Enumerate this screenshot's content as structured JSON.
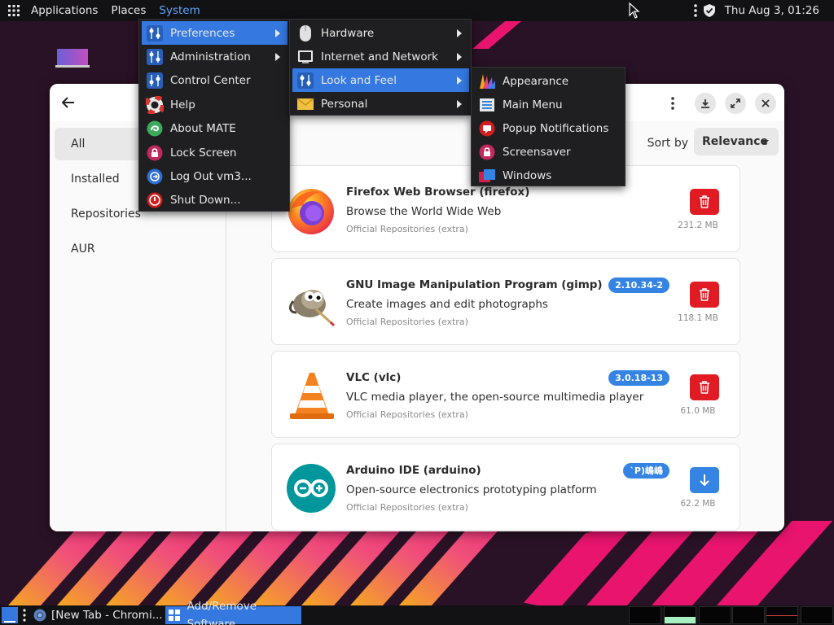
{
  "top_panel": {
    "menus": [
      "Applications",
      "Places",
      "System"
    ],
    "clock": "Thu Aug  3, 01:26"
  },
  "system_menu": {
    "items": [
      {
        "label": "Preferences",
        "icon": "preferences-icon",
        "submenu": true
      },
      {
        "label": "Administration",
        "icon": "administration-icon",
        "submenu": true
      },
      {
        "label": "Control Center",
        "icon": "control-center-icon",
        "submenu": false
      },
      {
        "label": "Help",
        "icon": "help-lifebuoy-icon",
        "submenu": false
      },
      {
        "label": "About MATE",
        "icon": "mate-logo-icon",
        "submenu": false
      },
      {
        "label": "Lock Screen",
        "icon": "lock-icon",
        "submenu": false
      },
      {
        "label": "Log Out vm3...",
        "icon": "logout-icon",
        "submenu": false
      },
      {
        "label": "Shut Down...",
        "icon": "power-icon",
        "submenu": false
      }
    ]
  },
  "preferences_menu": {
    "items": [
      {
        "label": "Hardware",
        "icon": "mouse-icon"
      },
      {
        "label": "Internet and Network",
        "icon": "network-icon"
      },
      {
        "label": "Look and Feel",
        "icon": "look-and-feel-icon"
      },
      {
        "label": "Personal",
        "icon": "personal-envelope-icon"
      }
    ]
  },
  "look_feel_menu": {
    "items": [
      {
        "label": "Appearance",
        "icon": "appearance-icon"
      },
      {
        "label": "Main Menu",
        "icon": "main-menu-icon"
      },
      {
        "label": "Popup Notifications",
        "icon": "popup-notifications-icon"
      },
      {
        "label": "Screensaver",
        "icon": "screensaver-icon"
      },
      {
        "label": "Windows",
        "icon": "windows-icon"
      }
    ]
  },
  "window": {
    "sort_label": "Sort by",
    "sort_value": "Relevance",
    "sidebar": [
      "All",
      "Installed",
      "Repositories",
      "AUR"
    ],
    "packages": [
      {
        "name": "Firefox Web Browser (firefox)",
        "desc": "Browse the World Wide Web",
        "repo": "Official Repositories (extra)",
        "version": "",
        "size": "231.2 MB",
        "action": "remove",
        "icon": "firefox-icon"
      },
      {
        "name": "GNU Image Manipulation Program (gimp)",
        "desc": "Create images and edit photographs",
        "repo": "Official Repositories (extra)",
        "version": "2.10.34-2",
        "size": "118.1 MB",
        "action": "remove",
        "icon": "gimp-icon"
      },
      {
        "name": "VLC (vlc)",
        "desc": "VLC media player, the open-source multimedia player",
        "repo": "Official Repositories (extra)",
        "version": "3.0.18-13",
        "size": "61.0 MB",
        "action": "remove",
        "icon": "vlc-icon"
      },
      {
        "name": "Arduino IDE (arduino)",
        "desc": "Open-source electronics prototyping platform",
        "repo": "Official Repositories (extra)",
        "version": "`P)嶋嶋",
        "size": "62.2 MB",
        "action": "install",
        "icon": "arduino-icon"
      }
    ]
  },
  "bottom_panel": {
    "tasks": [
      "[New Tab - Chromi...",
      "Add/Remove Software"
    ]
  },
  "colors": {
    "accent": "#3478e0",
    "remove": "#e01b24",
    "install": "#3584e4"
  }
}
